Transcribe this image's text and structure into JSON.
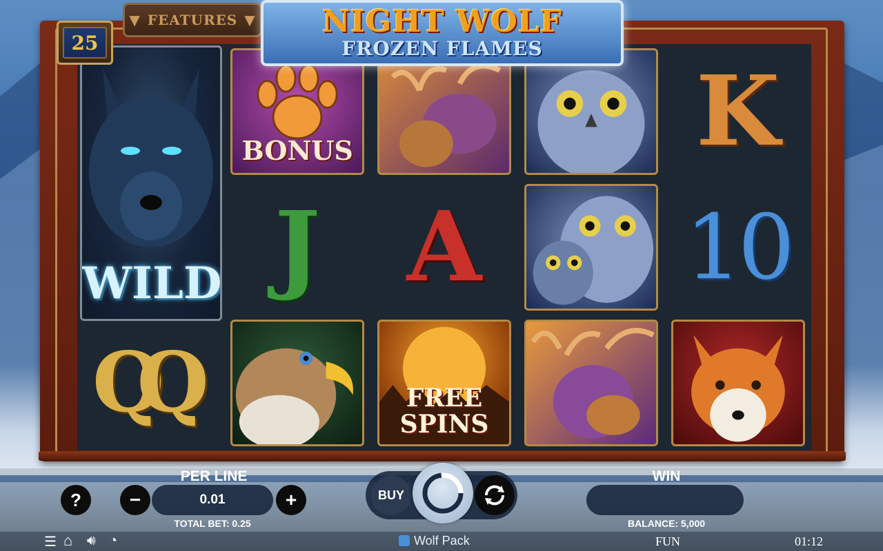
{
  "game": {
    "title_line1": "NIGHT WOLF",
    "title_line2": "FROZEN FLAMES",
    "lines_count": "25",
    "features_label": "FEATURES"
  },
  "reels": {
    "wild_label": "WILD",
    "bonus_label": "BONUS",
    "free_spins_label_1": "FREE",
    "free_spins_label_2": "SPINS",
    "letters": {
      "k": "K",
      "j": "J",
      "a": "A",
      "q": "Q",
      "ten": "10"
    },
    "symbols": [
      "wolf-wild",
      "paw-bonus",
      "moose",
      "owl",
      "K",
      "J",
      "A",
      "owls",
      "10",
      "Q",
      "eagle",
      "moon-free-spins",
      "moose",
      "fox"
    ]
  },
  "controls": {
    "help_label": "?",
    "per_line_label": "PER LINE",
    "per_line_value": "0.01",
    "minus_label": "−",
    "plus_label": "+",
    "total_bet_label": "TOTAL BET: 0.25",
    "buy_label": "BUY",
    "win_label": "WIN",
    "win_value": "",
    "balance_label": "BALANCE: 5,000"
  },
  "status": {
    "brand": "Wolf Pack",
    "mode": "FUN",
    "clock": "01:12"
  },
  "colors": {
    "frame": "#6e2412",
    "gold": "#b88a4a",
    "grid_bg": "#1c2732",
    "logo_orange": "#f0a020",
    "ten_blue": "#4a8fd8"
  }
}
